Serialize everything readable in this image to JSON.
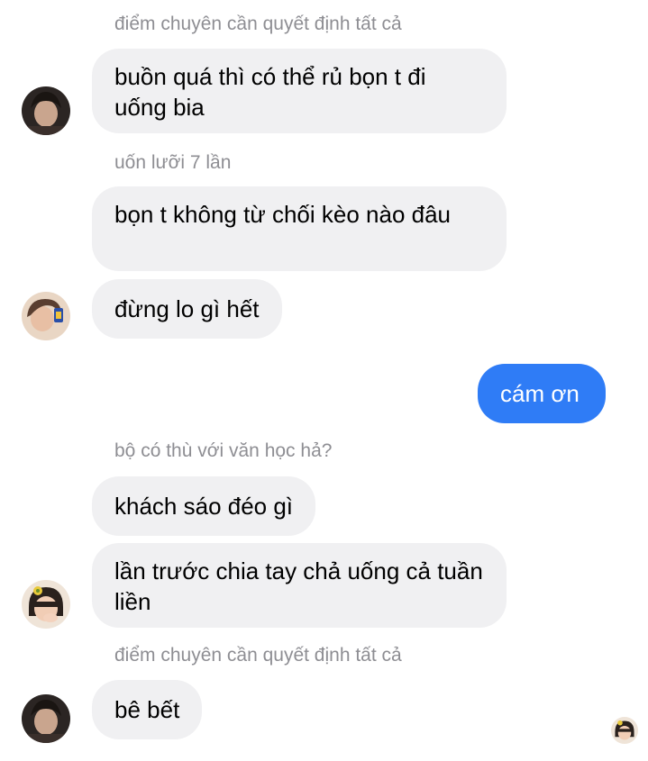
{
  "conversation": {
    "messages": [
      {
        "sender": "điểm chuyên cần quyết định tất cả",
        "text": "buồn quá thì có thể rủ bọn t đi uống bia"
      },
      {
        "sender": "uốn lưỡi 7 lần",
        "text": "bọn t không từ chối kèo nào đâu"
      },
      {
        "text": "đừng lo gì hết"
      },
      {
        "text": "cám ơn",
        "from_me": true
      },
      {
        "sender": "bộ có thù với văn học hả?",
        "text": "khách sáo đéo gì"
      },
      {
        "text": "lần trước chia tay chả uống cả tuần liền"
      },
      {
        "sender": "điểm chuyên cần quyết định tất cả",
        "text": "bê bết"
      }
    ]
  },
  "colors": {
    "incoming_bubble": "#f0f0f2",
    "outgoing_bubble": "#2f7cf6",
    "sender_name": "#8e8e93"
  },
  "icons": {
    "avatar": "user-avatar-icon",
    "read_receipt": "read-receipt-avatar-icon"
  }
}
